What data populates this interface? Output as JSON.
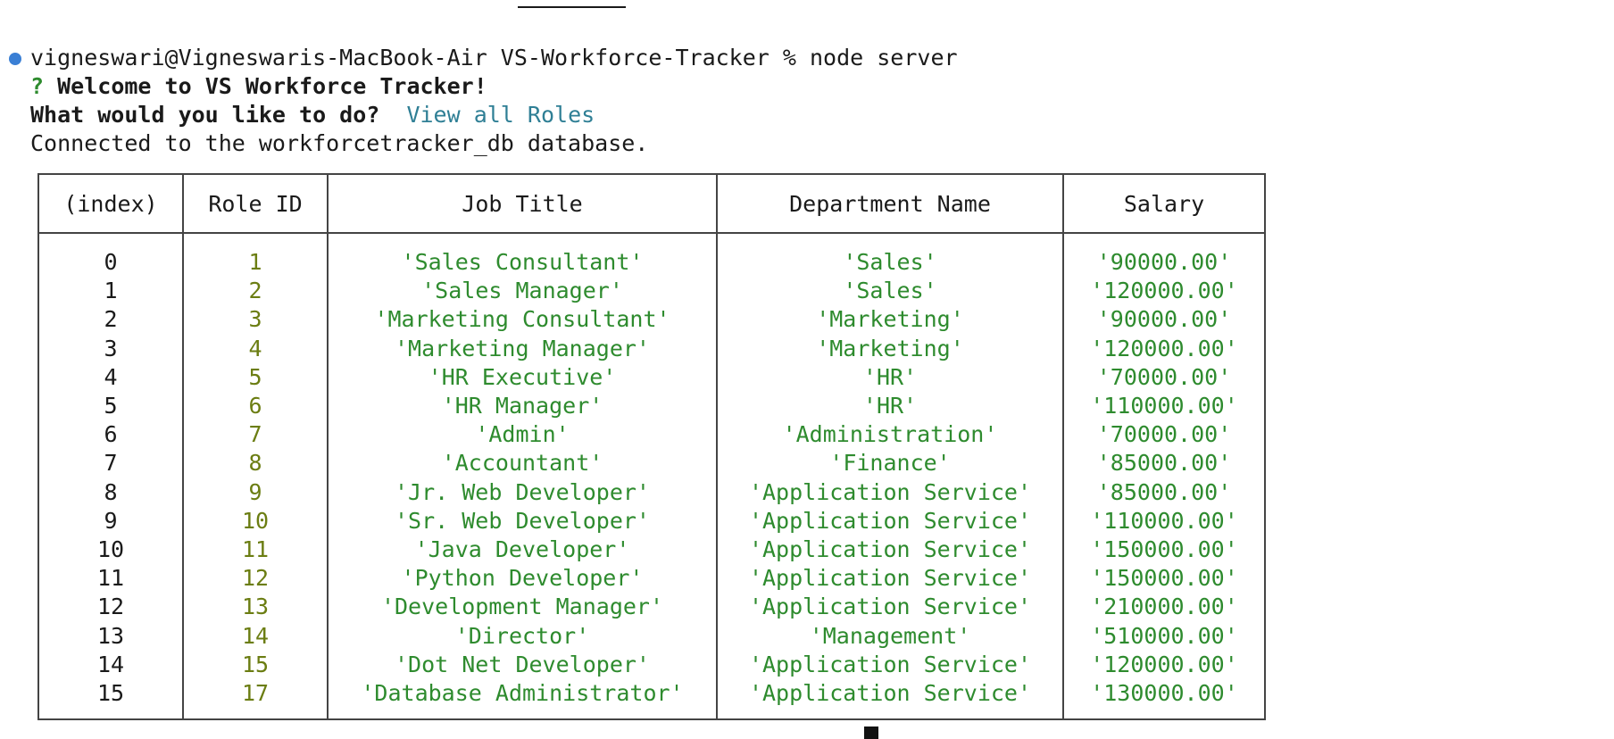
{
  "terminal": {
    "prompt": "vigneswari@Vigneswaris-MacBook-Air VS-Workforce-Tracker % ",
    "command": "node server",
    "welcome_mark": "?",
    "welcome_text": "Welcome to VS Workforce Tracker!",
    "question": "What would you like to do?",
    "answer": "View all Roles",
    "connected_msg": "Connected to the workforcetracker_db database.",
    "bottom_partial": ""
  },
  "colors": {
    "bullet": "#3a7fd5",
    "green": "#2e8b2e",
    "olive": "#6b7d12",
    "answer": "#2f7f95"
  },
  "table": {
    "headers": [
      "(index)",
      "Role ID",
      "Job Title",
      "Department Name",
      "Salary"
    ],
    "rows": [
      [
        "0",
        "1",
        "'Sales Consultant'",
        "'Sales'",
        "'90000.00'"
      ],
      [
        "1",
        "2",
        "'Sales Manager'",
        "'Sales'",
        "'120000.00'"
      ],
      [
        "2",
        "3",
        "'Marketing Consultant'",
        "'Marketing'",
        "'90000.00'"
      ],
      [
        "3",
        "4",
        "'Marketing Manager'",
        "'Marketing'",
        "'120000.00'"
      ],
      [
        "4",
        "5",
        "'HR Executive'",
        "'HR'",
        "'70000.00'"
      ],
      [
        "5",
        "6",
        "'HR Manager'",
        "'HR'",
        "'110000.00'"
      ],
      [
        "6",
        "7",
        "'Admin'",
        "'Administration'",
        "'70000.00'"
      ],
      [
        "7",
        "8",
        "'Accountant'",
        "'Finance'",
        "'85000.00'"
      ],
      [
        "8",
        "9",
        "'Jr. Web Developer'",
        "'Application Service'",
        "'85000.00'"
      ],
      [
        "9",
        "10",
        "'Sr. Web Developer'",
        "'Application Service'",
        "'110000.00'"
      ],
      [
        "10",
        "11",
        "'Java Developer'",
        "'Application Service'",
        "'150000.00'"
      ],
      [
        "11",
        "12",
        "'Python Developer'",
        "'Application Service'",
        "'150000.00'"
      ],
      [
        "12",
        "13",
        "'Development Manager'",
        "'Application Service'",
        "'210000.00'"
      ],
      [
        "13",
        "14",
        "'Director'",
        "'Management'",
        "'510000.00'"
      ],
      [
        "14",
        "15",
        "'Dot Net Developer'",
        "'Application Service'",
        "'120000.00'"
      ],
      [
        "15",
        "17",
        "'Database Administrator'",
        "'Application Service'",
        "'130000.00'"
      ]
    ]
  }
}
